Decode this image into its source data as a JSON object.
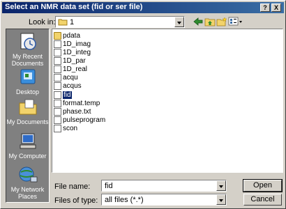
{
  "window": {
    "title": "Select an NMR data set (fid or ser file)",
    "help_label": "?",
    "close_label": "X"
  },
  "lookin": {
    "label": "Look in:",
    "value": "1"
  },
  "places": [
    {
      "label": "My Recent Documents",
      "icon": "recent-documents-icon"
    },
    {
      "label": "Desktop",
      "icon": "desktop-icon"
    },
    {
      "label": "My Documents",
      "icon": "my-documents-icon"
    },
    {
      "label": "My Computer",
      "icon": "my-computer-icon"
    },
    {
      "label": "My Network Places",
      "icon": "network-places-icon"
    }
  ],
  "files": [
    {
      "name": "pdata",
      "type": "folder"
    },
    {
      "name": "1D_imag",
      "type": "file"
    },
    {
      "name": "1D_integ",
      "type": "file"
    },
    {
      "name": "1D_par",
      "type": "file"
    },
    {
      "name": "1D_real",
      "type": "file"
    },
    {
      "name": "acqu",
      "type": "file"
    },
    {
      "name": "acqus",
      "type": "file"
    },
    {
      "name": "fid",
      "type": "file",
      "selected": true
    },
    {
      "name": "format.temp",
      "type": "file"
    },
    {
      "name": "phase.txt",
      "type": "file"
    },
    {
      "name": "pulseprogram",
      "type": "file"
    },
    {
      "name": "scon",
      "type": "file"
    }
  ],
  "filename": {
    "label": "File name:",
    "value": "fid"
  },
  "filetype": {
    "label": "Files of type:",
    "value": "all files (*.*)"
  },
  "buttons": {
    "open": "Open",
    "cancel": "Cancel"
  },
  "colors": {
    "title_gradient_start": "#0a246a",
    "title_gradient_end": "#3a6ea5",
    "dialog_face": "#d4d0c8",
    "selection": "#0a246a"
  }
}
